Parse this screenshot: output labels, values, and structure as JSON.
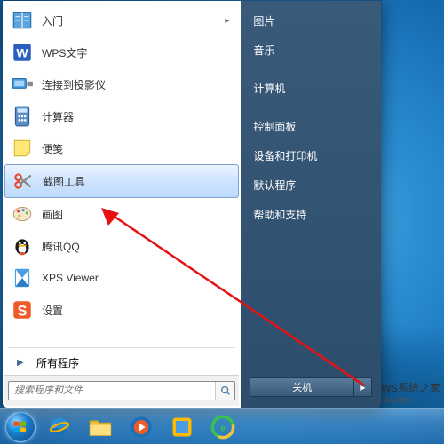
{
  "startmenu": {
    "items": [
      {
        "label": "入门",
        "icon": "book-icon",
        "chevron": true
      },
      {
        "label": "WPS文字",
        "icon": "wps-icon",
        "chevron": false
      },
      {
        "label": "连接到投影仪",
        "icon": "projector-icon",
        "chevron": false
      },
      {
        "label": "计算器",
        "icon": "calculator-icon",
        "chevron": false
      },
      {
        "label": "便笺",
        "icon": "sticky-notes-icon",
        "chevron": false
      },
      {
        "label": "截图工具",
        "icon": "snipping-tool-icon",
        "chevron": false,
        "selected": true
      },
      {
        "label": "画图",
        "icon": "paint-icon",
        "chevron": false
      },
      {
        "label": "腾讯QQ",
        "icon": "qq-icon",
        "chevron": false
      },
      {
        "label": "XPS Viewer",
        "icon": "xps-icon",
        "chevron": false
      },
      {
        "label": "设置",
        "icon": "sogou-icon",
        "chevron": false
      }
    ],
    "all_programs": "所有程序",
    "search_placeholder": "搜索程序和文件"
  },
  "right_panel": {
    "items": [
      "图片",
      "音乐",
      "计算机",
      "控制面板",
      "设备和打印机",
      "默认程序",
      "帮助和支持"
    ],
    "shutdown": "关机"
  },
  "watermark": {
    "brand": "Windows",
    "site": "系统之家",
    "url": "www.bjjmlv.com"
  }
}
